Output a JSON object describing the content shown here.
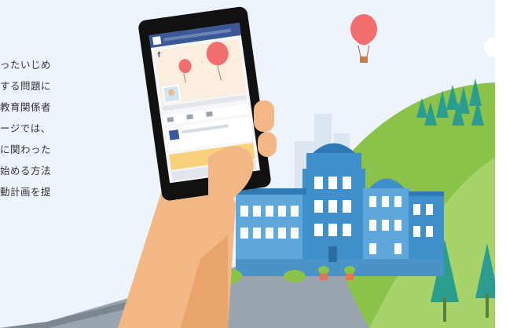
{
  "article": {
    "lines": [
      "ったいじめ",
      "する問題に",
      "教育関係者",
      "ージでは、",
      "に関わった",
      "始める方法",
      "動計画を提"
    ]
  },
  "phone": {
    "app_logo": "f",
    "logo_icon": "facebook-logo-icon"
  },
  "colors": {
    "sky": "#eef4fb",
    "hill": "#8bc34a",
    "building": "#3f8fcb",
    "skin": "#f2b784",
    "balloon": "#f26d6d",
    "fb_blue": "#3b5998"
  }
}
